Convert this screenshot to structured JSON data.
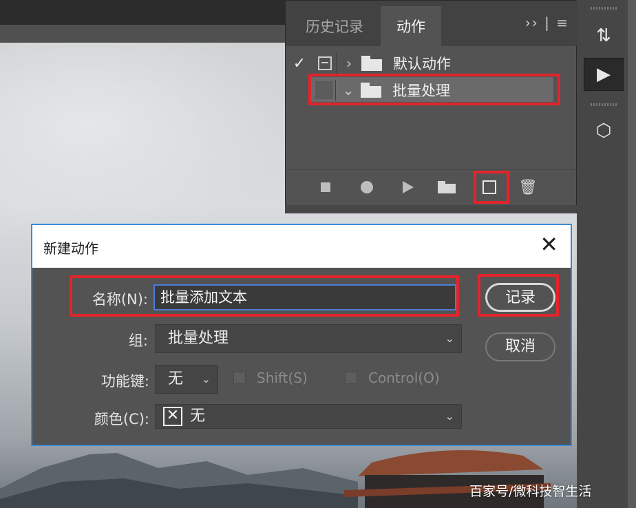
{
  "panel": {
    "tabs": [
      {
        "label": "历史记录",
        "active": false
      },
      {
        "label": "动作",
        "active": true
      }
    ],
    "menu_glyphs": "›› | ≡",
    "action_sets": [
      {
        "name": "默认动作",
        "enabled": true,
        "expanded": false,
        "check": "✓",
        "arrow": "›"
      },
      {
        "name": "批量处理",
        "enabled": false,
        "expanded": true,
        "selected": true,
        "arrow": "⌄"
      }
    ],
    "footer_tools": [
      "stop-recording",
      "begin-recording",
      "play-selection",
      "create-new-set",
      "create-new-action",
      "delete"
    ]
  },
  "dialog": {
    "title": "新建动作",
    "close": "✕",
    "name_label": "名称(N):",
    "name_value": "批量添加文本",
    "set_label": "组:",
    "set_value": "批量处理",
    "function_key_label": "功能键:",
    "function_key_value": "无",
    "shift_label": "Shift(S)",
    "control_label": "Control(O)",
    "color_label": "颜色(C):",
    "color_value": "无",
    "record_button": "记录",
    "cancel_button": "取消"
  },
  "watermark": "百家号/微科技智生活",
  "colors": {
    "annotation_red": "#e3242b",
    "focus_blue": "#4a7fd6",
    "panel_gray": "#535353"
  }
}
